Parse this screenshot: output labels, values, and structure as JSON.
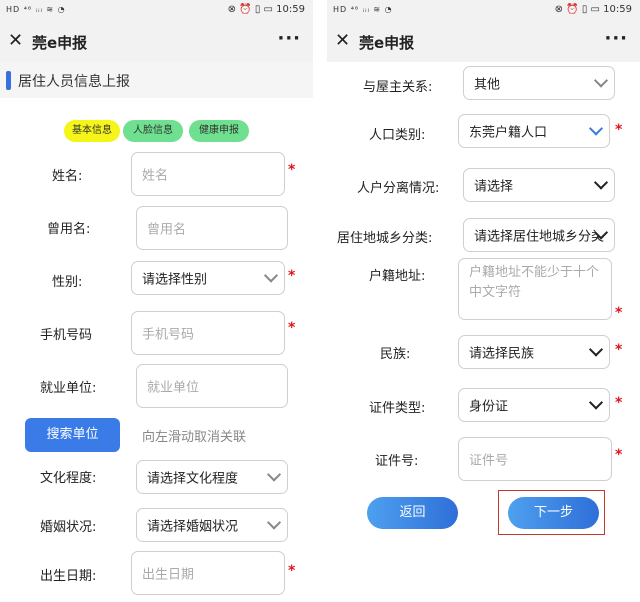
{
  "status": {
    "left": "HD ⁴⁶ ᵢᵢₗ ≋ ◔",
    "right": "⊗ ⏰ ▯ ▭ 10:59"
  },
  "nav": {
    "title": "莞e申报",
    "close": "✕",
    "more": "···"
  },
  "left": {
    "section_title": "居住人员信息上报",
    "tabs": [
      "基本信息",
      "人脸信息",
      "健康申报"
    ],
    "fields": {
      "name": {
        "label": "姓名:",
        "placeholder": "姓名"
      },
      "former_name": {
        "label": "曾用名:",
        "placeholder": "曾用名"
      },
      "gender": {
        "label": "性别:",
        "value": "请选择性别"
      },
      "phone": {
        "label": "手机号码",
        "placeholder": "手机号码"
      },
      "employer": {
        "label": "就业单位:",
        "placeholder": "就业单位"
      },
      "education": {
        "label": "文化程度:",
        "value": "请选择文化程度"
      },
      "marital": {
        "label": "婚姻状况:",
        "value": "请选择婚姻状况"
      },
      "birth": {
        "label": "出生日期:",
        "placeholder": "出生日期"
      }
    },
    "search_button": "搜索单位",
    "swipe_hint": "向左滑动取消关联",
    "required_mark": "*"
  },
  "right": {
    "fields": {
      "relation": {
        "label": "与屋主关系:",
        "value": "其他"
      },
      "population_type": {
        "label": "人口类别:",
        "value": "东莞户籍人口"
      },
      "household_separation": {
        "label": "人户分离情况:",
        "value": "请选择"
      },
      "urban_rural": {
        "label": "居住地城乡分类:",
        "value": "请选择居住地城乡分类"
      },
      "household_address": {
        "label": "户籍地址:",
        "placeholder": "户籍地址不能少于十个中文字符"
      },
      "ethnicity": {
        "label": "民族:",
        "value": "请选择民族"
      },
      "id_type": {
        "label": "证件类型:",
        "value": "身份证"
      },
      "id_number": {
        "label": "证件号:",
        "placeholder": "证件号"
      }
    },
    "back_button": "返回",
    "next_button": "下一步",
    "required_mark": "*"
  },
  "colors": {
    "accent": "#3b7be8",
    "required": "#e0141e",
    "tab_basic": "#f5f51a",
    "tab_face": "#6fe08f",
    "tab_health": "#6fe08f",
    "highlight_frame": "#c0392b"
  }
}
